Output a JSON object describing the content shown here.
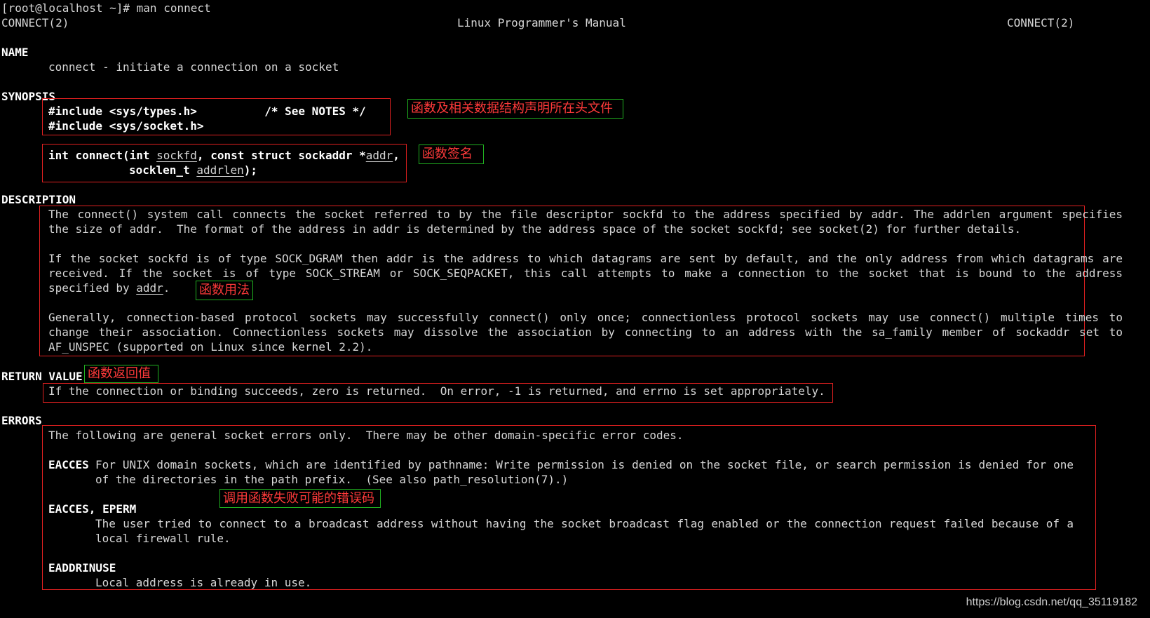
{
  "terminal": {
    "prompt": "[root@localhost ~]# man connect",
    "header_left": "CONNECT(2)",
    "header_center": "Linux Programmer's Manual",
    "header_right": "CONNECT(2)"
  },
  "sections": {
    "name": {
      "heading": "NAME",
      "text": "connect - initiate a connection on a socket"
    },
    "synopsis": {
      "heading": "SYNOPSIS",
      "include1": "#include <sys/types.h>          /* See NOTES */",
      "include2": "#include <sys/socket.h>",
      "sig_line1_a": "int connect(int ",
      "sig_sockfd": "sockfd",
      "sig_line1_b": ", const struct sockaddr *",
      "sig_addr": "addr",
      "sig_line1_c": ",",
      "sig_line2_a": "socklen_t ",
      "sig_addrlen": "addrlen",
      "sig_line2_b": ");"
    },
    "description": {
      "heading": "DESCRIPTION",
      "p1_l1": "The connect() system call connects the socket referred to by the file descriptor sockfd to the address specified by addr.  The addrlen argument specifies",
      "p1_l2": "the size of addr.  The format of the address in addr is determined by the address space of the socket sockfd; see socket(2) for further details.",
      "p2_l1": "If the socket sockfd is of type SOCK_DGRAM then addr is the address to which datagrams are sent by default, and the only address from which datagrams are",
      "p2_l2": "received.  If the socket is of type SOCK_STREAM or SOCK_SEQPACKET, this call attempts to make a connection to the socket that is bound to the address",
      "p2_l3_a": "specified by ",
      "p2_l3_addr": "addr",
      "p2_l3_b": ".",
      "p3_l1": "Generally, connection-based protocol sockets may successfully connect() only once; connectionless protocol sockets may use connect() multiple times to",
      "p3_l2": "change their association.  Connectionless sockets may dissolve the association by connecting to an address with the sa_family member of sockaddr set to",
      "p3_l3": "AF_UNSPEC (supported on Linux since kernel 2.2)."
    },
    "return_value": {
      "heading": "RETURN VALUE",
      "text": "If the connection or binding succeeds, zero is returned.  On error, -1 is returned, and errno is set appropriately."
    },
    "errors": {
      "heading": "ERRORS",
      "intro": "The following are general socket errors only.  There may be other domain-specific error codes.",
      "e1_name": "EACCES",
      "e1_l1": "For UNIX domain sockets, which are identified by pathname: Write permission is denied on the socket file, or search permission is denied  for  one",
      "e1_l2": "of the directories in the path prefix.  (See also path_resolution(7).)",
      "e2_name": "EACCES, EPERM",
      "e2_l1": "The  user  tried  to connect to a broadcast address without having the socket broadcast flag enabled or the connection request failed because of a",
      "e2_l2": "local firewall rule.",
      "e3_name": "EADDRINUSE",
      "e3_l1": "Local address is already in use."
    }
  },
  "annotations": {
    "header_files": "函数及相关数据结构声明所在头文件",
    "signature": "函数签名",
    "usage": "函数用法",
    "return": "函数返回值",
    "errors": "调用函数失败可能的错误码"
  },
  "watermark": "https://blog.csdn.net/qq_35119182",
  "colors": {
    "background": "#000000",
    "text": "#d6d6d6",
    "red_box": "#e02020",
    "green_box": "#20b020",
    "annotation_text": "#ff3a3a"
  }
}
